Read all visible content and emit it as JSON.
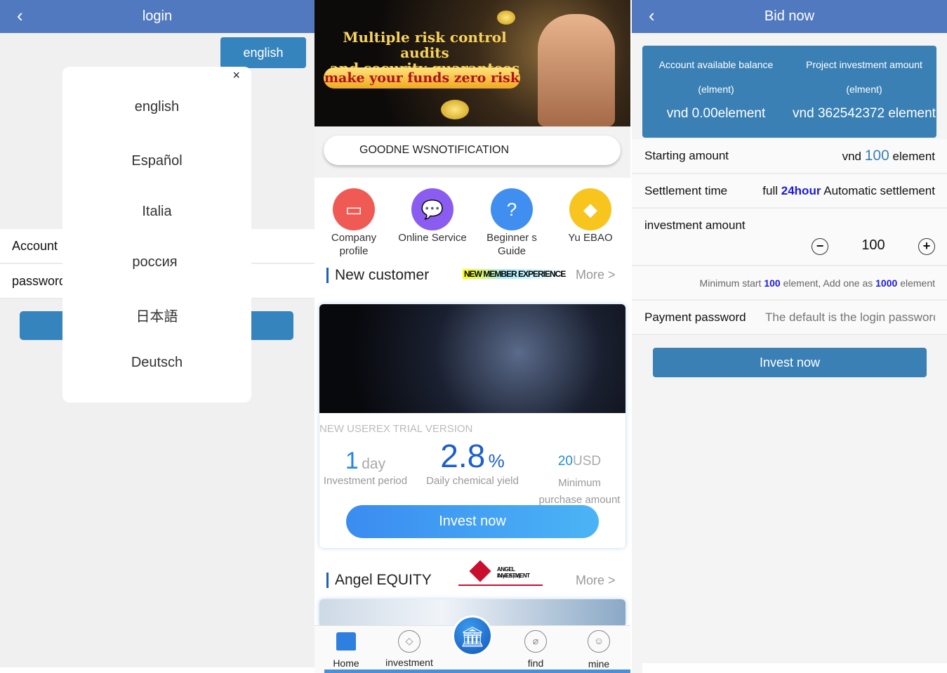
{
  "login": {
    "title": "login",
    "lang_button": "english",
    "account_label": "Account",
    "password_label": "password",
    "languages": [
      "english",
      "Español",
      "Italia",
      "россия",
      "日本語",
      "Deutsch"
    ],
    "close": "×"
  },
  "home": {
    "banner": {
      "line1": "Multiple risk control audits",
      "line2": "and security guarantees",
      "line3": "make your funds zero risk"
    },
    "notification": "GOODNE WSNOTIFICATION",
    "quick": [
      {
        "label1": "Company",
        "label2": "profile",
        "icon": "briefcase-icon",
        "color": "#f05a55"
      },
      {
        "label1": "Online Service",
        "label2": "",
        "icon": "chat-icon",
        "color": "#8a5cf0"
      },
      {
        "label1": "Beginner s",
        "label2": "Guide",
        "icon": "question-icon",
        "color": "#3f8ef0"
      },
      {
        "label1": "Yu EBAO",
        "label2": "",
        "icon": "money-bag-icon",
        "color": "#f8c51e"
      }
    ],
    "new_customer": {
      "title": "New customer",
      "logo": "NEW MEMBER EXPERIENCE",
      "more": "More >"
    },
    "product": {
      "name": "NEW USEREX TRIAL VERSION",
      "period_value": "1",
      "period_unit": "day",
      "period_label": "Investment period",
      "yield_value": "2.8",
      "yield_unit": "%",
      "yield_label": "Daily chemical yield",
      "min_value": "20",
      "min_unit": "USD",
      "min_label1": "Minimum",
      "min_label2": "purchase amount",
      "button": "Invest now"
    },
    "angel": {
      "title": "Angel EQUITY",
      "logo1": "ANGEL INVESTMENT",
      "logo2": "Angel Equity",
      "more": "More >"
    },
    "nav": [
      {
        "label": "Home"
      },
      {
        "label": "investment"
      },
      {
        "label": ""
      },
      {
        "label": "find"
      },
      {
        "label": "mine"
      }
    ]
  },
  "bid": {
    "title": "Bid now",
    "balance_label": "Account available balance",
    "balance_unit": "(elment)",
    "balance_value": "vnd 0.00element",
    "project_label": "Project investment amount",
    "project_unit": "(elment)",
    "project_value": "vnd 362542372 element",
    "starting_label": "Starting amount",
    "starting_pre": "vnd",
    "starting_value": "100",
    "starting_post": "element",
    "settlement_label": "Settlement time",
    "settlement_pre": "full",
    "settlement_value": "24hour",
    "settlement_post": "Automatic settlement",
    "investment_label": "investment amount",
    "investment_value": "100",
    "hint_pre": "Minimum start",
    "hint_min": "100",
    "hint_mid": "element,  Add one as",
    "hint_step": "1000",
    "hint_post": "element",
    "payment_label": "Payment password",
    "payment_placeholder": "The default is the login password",
    "button": "Invest now"
  }
}
